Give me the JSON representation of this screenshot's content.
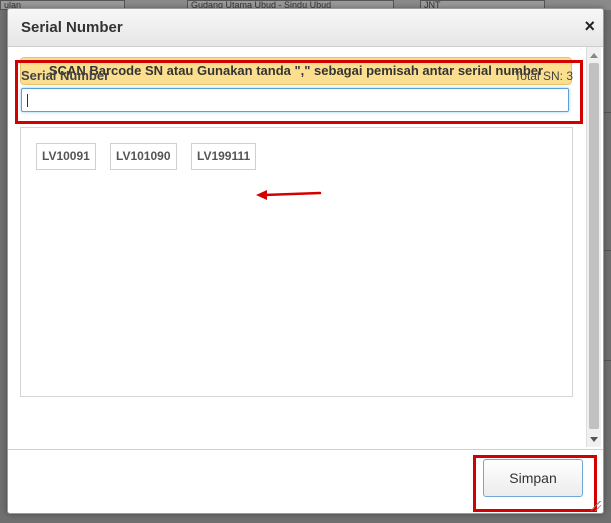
{
  "background": {
    "field_1": "ulan",
    "field_2": "Gudang Utama Ubud - Sindu Ubud",
    "field_3": "JNT"
  },
  "modal": {
    "title": "Serial Number",
    "notice": "SCAN Barcode SN atau Gunakan tanda \",\" sebagai pemisah antar serial number",
    "sn_label": "Serial Number",
    "total_sn": "Total SN: 3",
    "input": {
      "value": "",
      "placeholder": ""
    },
    "serial_numbers": [
      "LV10091",
      "LV101090",
      "LV199111"
    ],
    "save_label": "Simpan"
  },
  "colors": {
    "notice_bg": "#fcdf8e",
    "annotation": "#d40000",
    "input_focus": "#5fa0d8"
  }
}
